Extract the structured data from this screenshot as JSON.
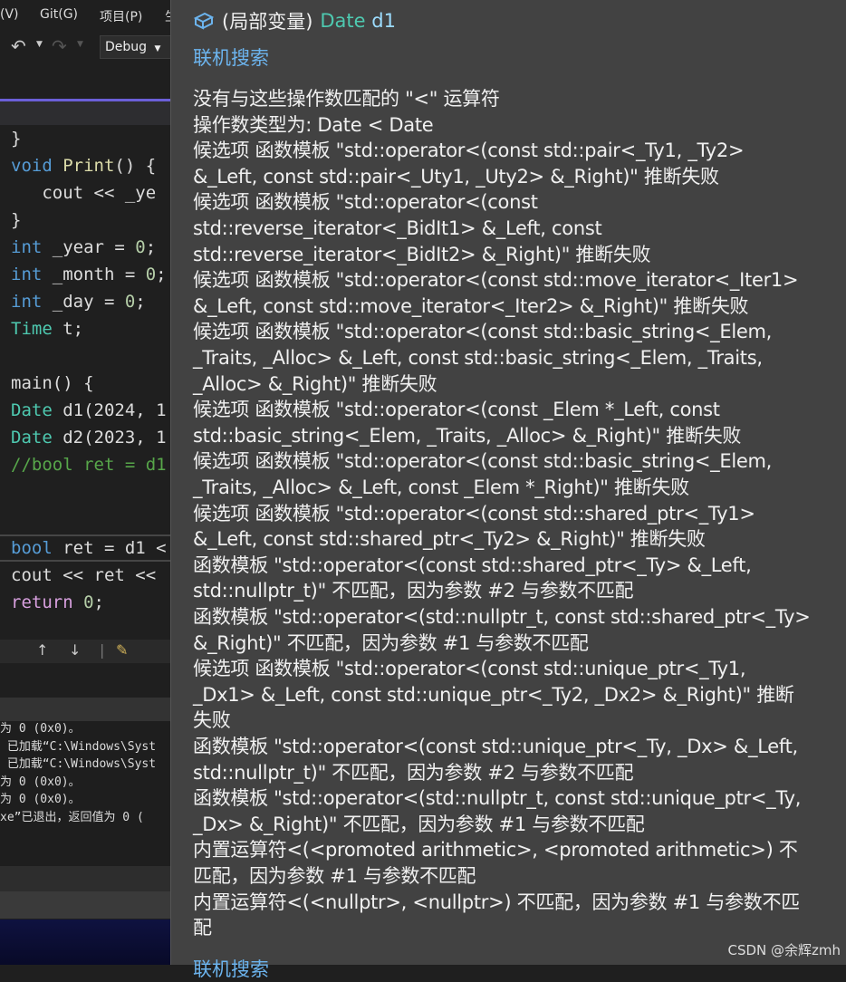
{
  "menu": [
    "(V)",
    "Git(G)",
    "项目(P)",
    "生"
  ],
  "toolbar": {
    "config": "Debug"
  },
  "code": [
    [
      [
        "pl",
        "}"
      ]
    ],
    [
      [
        "kw",
        "void "
      ],
      [
        "fn",
        "Print"
      ],
      [
        "pl",
        "() {"
      ]
    ],
    [
      [
        "pl",
        "   cout << _ye"
      ]
    ],
    [
      [
        "pl",
        "}"
      ]
    ],
    [
      [
        "kw",
        "int "
      ],
      [
        "pl",
        "_year = "
      ],
      [
        "nm",
        "0"
      ],
      [
        "pl",
        ";"
      ]
    ],
    [
      [
        "kw",
        "int "
      ],
      [
        "pl",
        "_month = "
      ],
      [
        "nm",
        "0"
      ],
      [
        "pl",
        ";"
      ]
    ],
    [
      [
        "kw",
        "int "
      ],
      [
        "pl",
        "_day = "
      ],
      [
        "nm",
        "0"
      ],
      [
        "pl",
        ";"
      ]
    ],
    [
      [
        "ty",
        "Time "
      ],
      [
        "pl",
        "t;"
      ]
    ],
    [],
    [
      [
        "pl",
        "main() {"
      ]
    ],
    [
      [
        "ty",
        "Date "
      ],
      [
        "pl",
        "d1(2024, 1"
      ]
    ],
    [
      [
        "ty",
        "Date "
      ],
      [
        "pl",
        "d2(2023, 1"
      ]
    ],
    [
      [
        "cm",
        "//bool ret = d1"
      ]
    ]
  ],
  "code_bottom": [
    [
      [
        "kw",
        "bool "
      ],
      [
        "pl",
        "ret = d1 <"
      ]
    ],
    [
      [
        "pl",
        "cout << ret <<"
      ]
    ],
    [
      [
        "ct",
        "return "
      ],
      [
        "nm",
        "0"
      ],
      [
        "pl",
        ";"
      ]
    ]
  ],
  "findbar": {
    "up": "↑",
    "down": "↓"
  },
  "output": [
    "为 0 (0x0)。",
    " 已加载“C:\\Windows\\Syst",
    " 已加载“C:\\Windows\\Syst",
    "为 0 (0x0)。",
    "为 0 (0x0)。",
    "xe”已退出，返回值为 0 ("
  ],
  "tooltip": {
    "prefix": "(局部变量)",
    "type": "Date",
    "name": "d1",
    "online_search": "联机搜索",
    "lines": [
      "没有与这些操作数匹配的 \"<\" 运算符",
      "          操作数类型为:  Date < Date",
      "候选项 函数模板 \"std::operator<(const std::pair<_Ty1, _Ty2>",
      "&_Left, const std::pair<_Uty1, _Uty2> &_Right)\" 推断失败",
      "候选项 函数模板 \"std::operator<(const",
      "std::reverse_iterator<_BidIt1> &_Left, const",
      "std::reverse_iterator<_BidIt2> &_Right)\" 推断失败",
      "候选项 函数模板 \"std::operator<(const std::move_iterator<_Iter1>",
      "&_Left, const std::move_iterator<_Iter2> &_Right)\" 推断失败",
      "候选项 函数模板 \"std::operator<(const std::basic_string<_Elem,",
      "_Traits, _Alloc> &_Left, const std::basic_string<_Elem, _Traits,",
      "_Alloc> &_Right)\" 推断失败",
      "候选项 函数模板 \"std::operator<(const _Elem *_Left, const",
      "std::basic_string<_Elem, _Traits, _Alloc> &_Right)\" 推断失败",
      "候选项 函数模板 \"std::operator<(const std::basic_string<_Elem,",
      "_Traits, _Alloc> &_Left, const _Elem *_Right)\" 推断失败",
      "候选项 函数模板 \"std::operator<(const std::shared_ptr<_Ty1>",
      "&_Left, const std::shared_ptr<_Ty2> &_Right)\" 推断失败",
      "函数模板 \"std::operator<(const std::shared_ptr<_Ty> &_Left,",
      "std::nullptr_t)\" 不匹配，因为参数 #2 与参数不匹配",
      "函数模板 \"std::operator<(std::nullptr_t, const std::shared_ptr<_Ty>",
      "&_Right)\" 不匹配，因为参数 #1 与参数不匹配",
      "候选项 函数模板 \"std::operator<(const std::unique_ptr<_Ty1,",
      "_Dx1> &_Left, const std::unique_ptr<_Ty2, _Dx2> &_Right)\" 推断",
      "失败",
      "函数模板 \"std::operator<(const std::unique_ptr<_Ty, _Dx> &_Left,",
      "std::nullptr_t)\" 不匹配，因为参数 #2 与参数不匹配",
      "函数模板 \"std::operator<(std::nullptr_t, const std::unique_ptr<_Ty,",
      "_Dx> &_Right)\" 不匹配，因为参数 #1 与参数不匹配",
      "内置运算符<(<promoted arithmetic>, <promoted arithmetic>) 不",
      "匹配，因为参数 #1 与参数不匹配",
      "内置运算符<(<nullptr>, <nullptr>) 不匹配，因为参数 #1 与参数不匹",
      "配"
    ]
  },
  "watermark": "CSDN @余辉zmh"
}
